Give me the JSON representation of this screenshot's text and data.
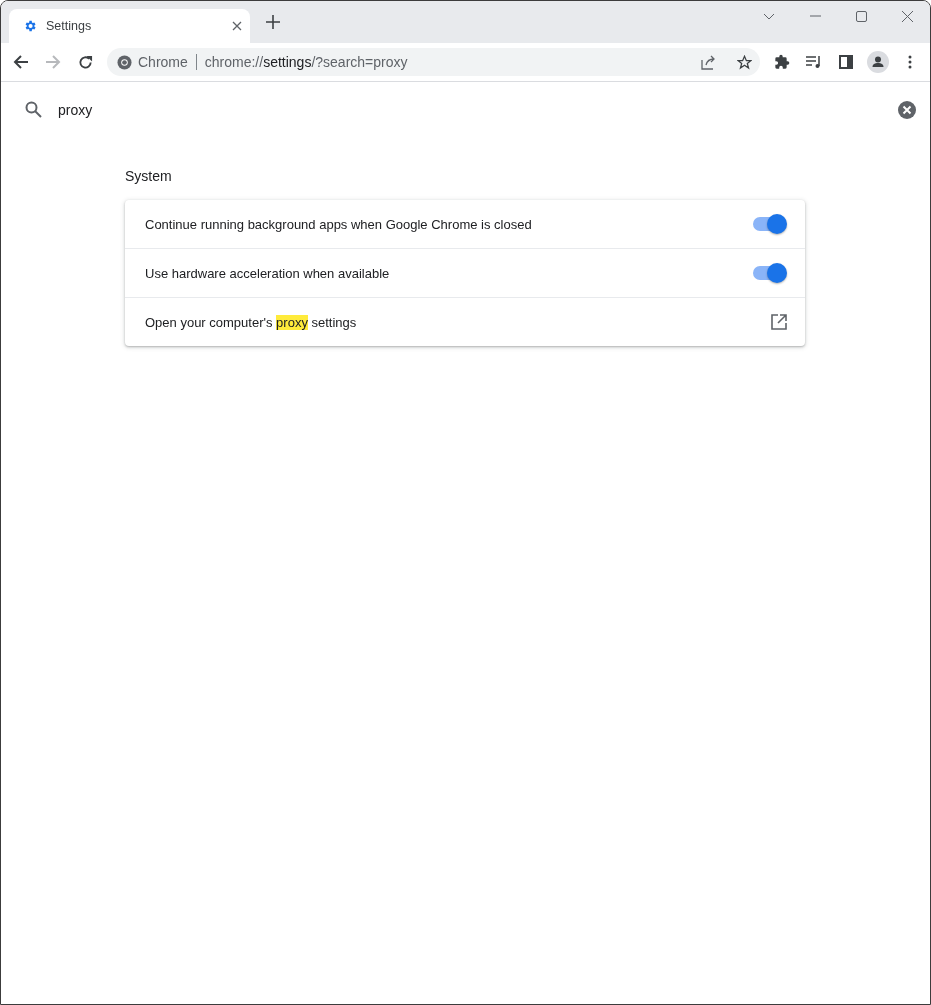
{
  "tab": {
    "title": "Settings",
    "selected": true
  },
  "omnibox": {
    "site_label": "Chrome",
    "url": [
      {
        "text": "chrome://",
        "emphasis": false
      },
      {
        "text": "settings",
        "emphasis": true
      },
      {
        "text": "/?search=proxy",
        "emphasis": false
      }
    ]
  },
  "search": {
    "value": "proxy"
  },
  "section": {
    "title": "System"
  },
  "rows": [
    {
      "kind": "toggle",
      "label": [
        {
          "text": "Continue running background apps when Google Chrome is closed",
          "highlight": false
        }
      ],
      "on": true
    },
    {
      "kind": "toggle",
      "label": [
        {
          "text": "Use hardware acceleration when available",
          "highlight": false
        }
      ],
      "on": true
    },
    {
      "kind": "link",
      "label": [
        {
          "text": "Open your computer's ",
          "highlight": false
        },
        {
          "text": "proxy",
          "highlight": true
        },
        {
          "text": " settings",
          "highlight": false
        }
      ]
    }
  ]
}
